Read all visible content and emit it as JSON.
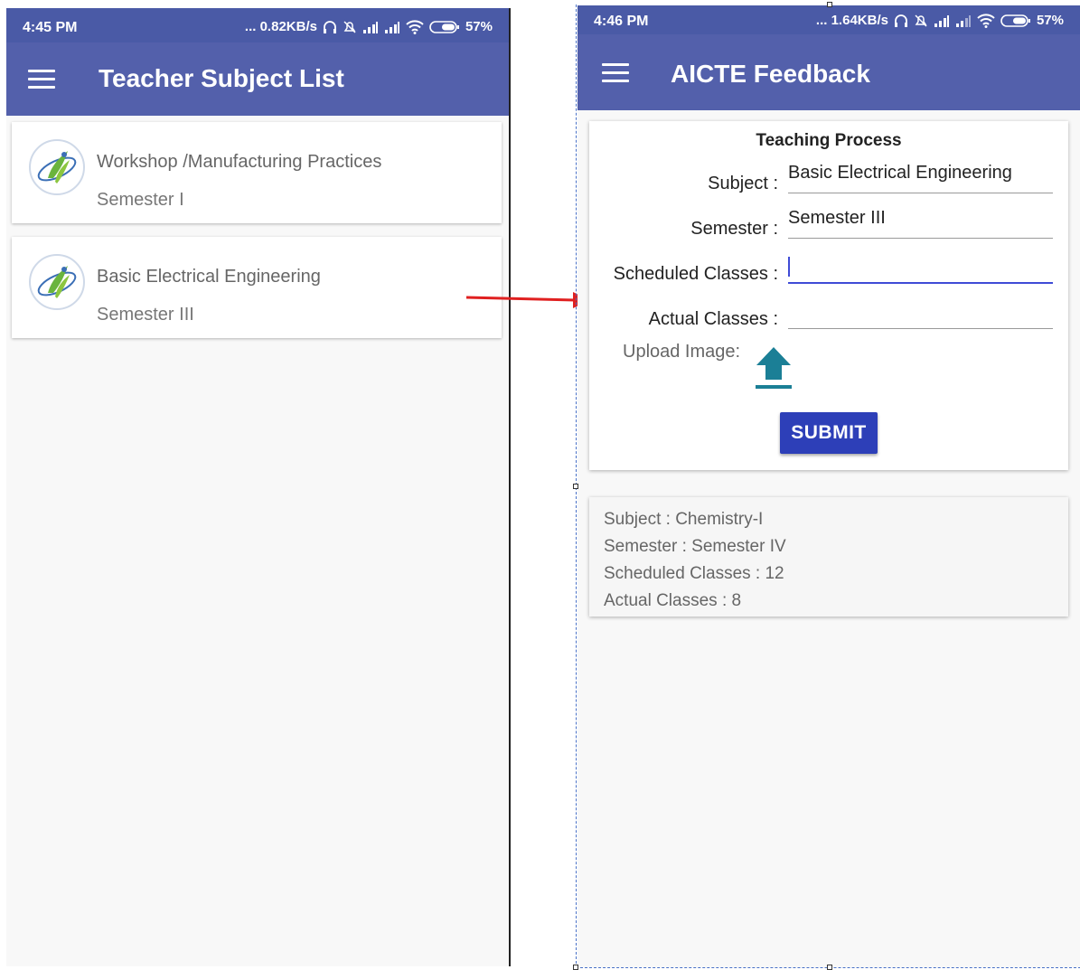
{
  "left_screen": {
    "status": {
      "time": "4:45 PM",
      "network": "... 0.82KB/s",
      "battery": "57%"
    },
    "title": "Teacher Subject List",
    "subjects": [
      {
        "name": "Workshop /Manufacturing Practices",
        "semester": "Semester I"
      },
      {
        "name": "Basic Electrical Engineering",
        "semester": "Semester III"
      }
    ]
  },
  "right_screen": {
    "status": {
      "time": "4:46 PM",
      "network": "... 1.64KB/s",
      "battery": "57%"
    },
    "title": "AICTE Feedback",
    "form": {
      "heading": "Teaching Process",
      "subject_label": "Subject :",
      "subject_value": "Basic Electrical Engineering",
      "semester_label": "Semester :",
      "semester_value": "Semester III",
      "scheduled_label": "Scheduled Classes :",
      "scheduled_value": "",
      "actual_label": "Actual Classes :",
      "actual_value": "",
      "upload_label": "Upload Image:",
      "submit_label": "SUBMIT"
    },
    "history": [
      "Subject : Chemistry-I",
      "Semester : Semester IV",
      "Scheduled Classes : 12",
      "Actual Classes : 8"
    ]
  },
  "colors": {
    "appbar": "#5360ab",
    "statusbar": "#4a5aa6",
    "submit": "#2d3fb8",
    "upload_icon": "#1b7f96",
    "arrow": "#e02020"
  },
  "icons": [
    "menu-icon",
    "app-logo-icon",
    "upload-icon",
    "wifi-icon",
    "signal-icon",
    "battery-icon",
    "headphones-icon",
    "mute-icon"
  ]
}
